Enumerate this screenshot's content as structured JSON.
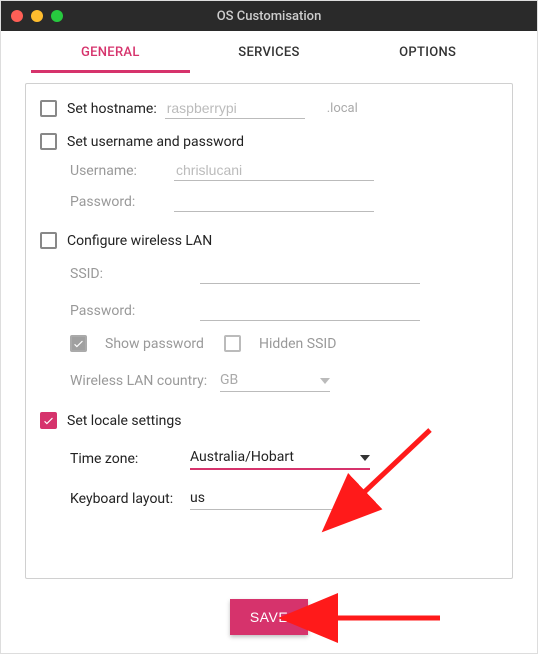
{
  "window": {
    "title": "OS Customisation"
  },
  "tabs": {
    "general": "GENERAL",
    "services": "SERVICES",
    "options": "OPTIONS"
  },
  "hostname": {
    "label": "Set hostname:",
    "placeholder": "raspberrypi",
    "value": "",
    "suffix": ".local",
    "checked": false
  },
  "userpass": {
    "label": "Set username and password",
    "checked": false,
    "username_label": "Username:",
    "username_value": "chrislucani",
    "password_label": "Password:",
    "password_value": ""
  },
  "wifi": {
    "label": "Configure wireless LAN",
    "checked": false,
    "ssid_label": "SSID:",
    "ssid_value": "",
    "password_label": "Password:",
    "password_value": "",
    "show_password_label": "Show password",
    "show_password_checked": true,
    "hidden_ssid_label": "Hidden SSID",
    "hidden_ssid_checked": false,
    "country_label": "Wireless LAN country:",
    "country_value": "GB"
  },
  "locale": {
    "label": "Set locale settings",
    "checked": true,
    "timezone_label": "Time zone:",
    "timezone_value": "Australia/Hobart",
    "keyboard_label": "Keyboard layout:",
    "keyboard_value": "us"
  },
  "buttons": {
    "save": "SAVE"
  },
  "colors": {
    "accent": "#d6336c",
    "arrow": "#ff1a1a"
  }
}
